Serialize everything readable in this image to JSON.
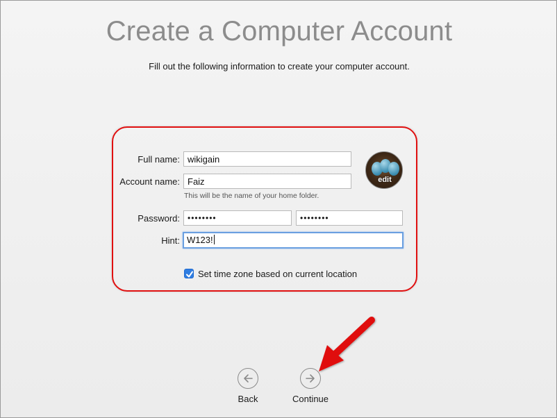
{
  "header": {
    "title": "Create a Computer Account",
    "subtitle": "Fill out the following information to create your computer account."
  },
  "form": {
    "full_name": {
      "label": "Full name:",
      "value": "wikigain"
    },
    "account_name": {
      "label": "Account name:",
      "value": "Faiz",
      "note": "This will be the name of your home folder."
    },
    "password": {
      "label": "Password:",
      "value": "••••••••",
      "verify_value": "••••••••"
    },
    "hint": {
      "label": "Hint:",
      "value": "W123!"
    },
    "avatar": {
      "edit_label": "edit"
    },
    "timezone": {
      "label": "Set time zone based on current location",
      "checked": true
    }
  },
  "nav": {
    "back_label": "Back",
    "continue_label": "Continue"
  },
  "colors": {
    "highlight": "#e01010",
    "accent": "#2f7de1",
    "arrow": "#e01010"
  },
  "icons": {
    "back": "arrow-left-circle-icon",
    "continue": "arrow-right-circle-icon",
    "check": "checkmark-icon"
  }
}
